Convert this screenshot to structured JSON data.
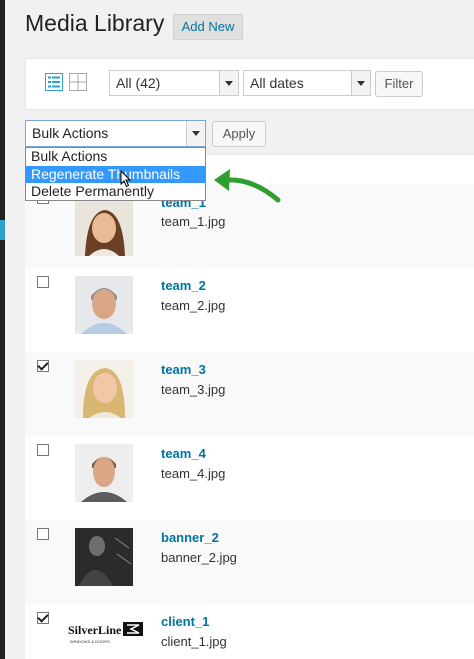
{
  "page": {
    "title": "Media Library",
    "add_new_label": "Add New"
  },
  "toolbar": {
    "type_filter": "All (42)",
    "date_filter": "All dates",
    "filter_label": "Filter"
  },
  "bulk": {
    "selected": "Bulk Actions",
    "apply_label": "Apply",
    "options": [
      "Bulk Actions",
      "Regenerate Thumbnails",
      "Delete Permanently"
    ],
    "highlighted_option": "Regenerate Thumbnails"
  },
  "colors": {
    "link": "#0074a2",
    "highlight": "#3399ff",
    "annotation_arrow": "#2e9e2e"
  },
  "media": [
    {
      "title": "team_1",
      "file": "team_1.jpg",
      "checked": true
    },
    {
      "title": "team_2",
      "file": "team_2.jpg",
      "checked": false
    },
    {
      "title": "team_3",
      "file": "team_3.jpg",
      "checked": true
    },
    {
      "title": "team_4",
      "file": "team_4.jpg",
      "checked": false
    },
    {
      "title": "banner_2",
      "file": "banner_2.jpg",
      "checked": false
    },
    {
      "title": "client_1",
      "file": "client_1.jpg",
      "checked": true
    }
  ],
  "logo_text": {
    "brand": "SilverLine",
    "sub": "WINDOWS & DOORS"
  }
}
